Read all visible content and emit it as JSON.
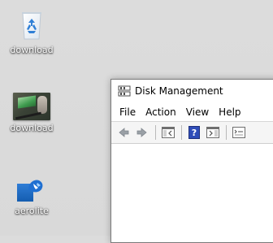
{
  "desktop": {
    "icons": [
      {
        "label": "download",
        "icon": "recycle-bin-icon"
      },
      {
        "label": "download",
        "icon": "photo-thumbnail-icon"
      },
      {
        "label": "aerolite",
        "icon": "aerolite-app-icon"
      }
    ]
  },
  "window": {
    "title": "Disk Management",
    "icon": "disk-management-icon",
    "menu": [
      "File",
      "Action",
      "View",
      "Help"
    ],
    "toolbar": [
      "back-arrow-icon",
      "forward-arrow-icon",
      "show-hide-console-tree-icon",
      "help-icon",
      "show-hide-action-pane-icon",
      "properties-icon"
    ]
  },
  "colors": {
    "desktop_background": "#dcdcdc",
    "window_background": "#ffffff",
    "accent_blue": "#1f78d1"
  }
}
